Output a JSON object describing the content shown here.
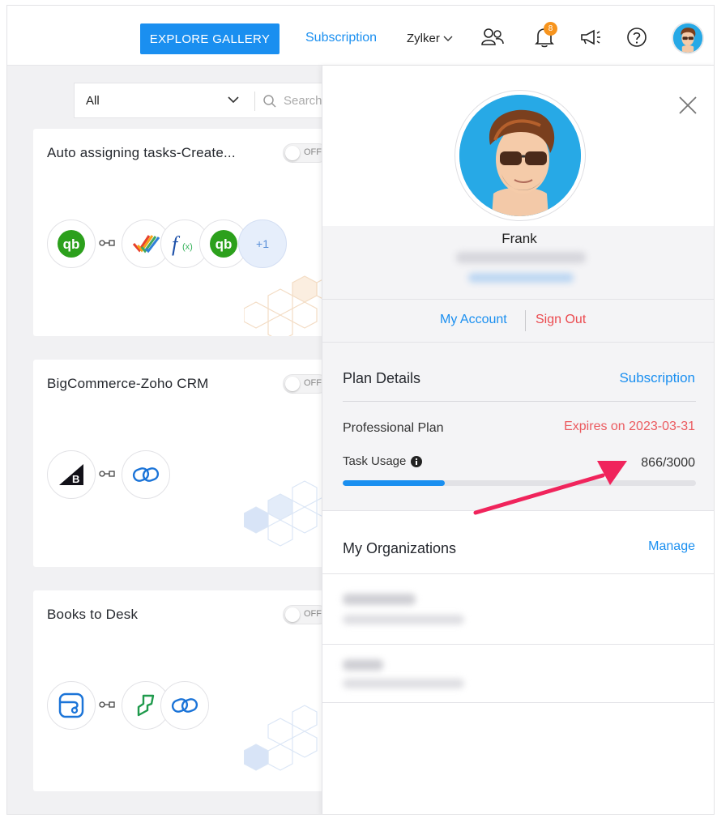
{
  "topbar": {
    "explore_label": "EXPLORE GALLERY",
    "subscription_label": "Subscription",
    "org_name": "Zylker",
    "notification_count": "8"
  },
  "filter": {
    "selected": "All",
    "search_placeholder": "Search"
  },
  "cards": [
    {
      "title": "Auto assigning tasks-Create...",
      "toggle": "OFF",
      "extra_count": "+1"
    },
    {
      "title": "BigCommerce-Zoho CRM",
      "toggle": "OFF"
    },
    {
      "title": "Books to Desk",
      "toggle": "OFF"
    }
  ],
  "profile": {
    "name": "Frank",
    "my_account": "My Account",
    "sign_out": "Sign Out"
  },
  "plan": {
    "title": "Plan Details",
    "subscription_link": "Subscription",
    "plan_name": "Professional Plan",
    "expiry": "Expires on 2023-03-31",
    "task_usage_label": "Task Usage",
    "task_usage_value": "866/3000",
    "task_used": 866,
    "task_limit": 3000
  },
  "organizations": {
    "title": "My Organizations",
    "manage_label": "Manage"
  },
  "colors": {
    "accent": "#1a8ff0",
    "danger": "#eb4a4f",
    "arrow": "#f0245c",
    "badge": "#f7941d"
  }
}
